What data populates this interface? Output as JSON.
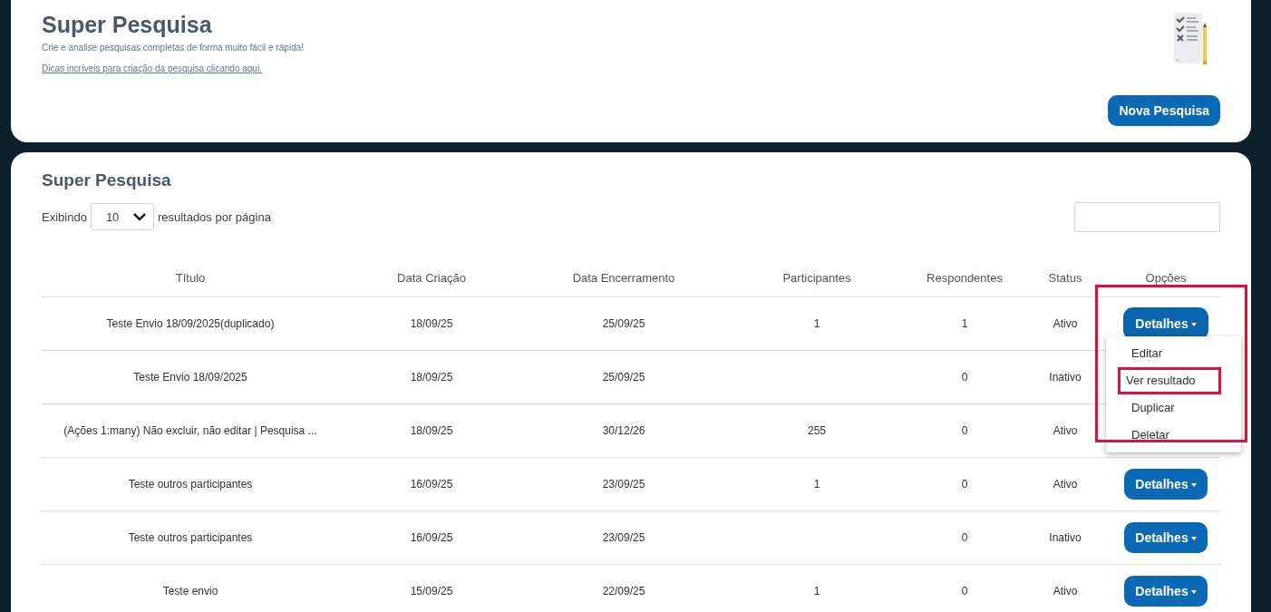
{
  "header": {
    "title": "Super Pesquisa",
    "subtitle": "Crie e analise pesquisas completas de forma muito fácil e rápida!",
    "tips_link": "Dicas incríveis para criação da pesquisa clicando aqui.",
    "new_button": "Nova Pesquisa"
  },
  "list": {
    "title": "Super Pesquisa",
    "show_prefix": "Exibindo",
    "page_size": "10",
    "show_suffix": "resultados por página",
    "columns": [
      "Título",
      "Data Criação",
      "Data Encerramento",
      "Participantes",
      "Respondentes",
      "Status",
      "Opções"
    ],
    "rows": [
      {
        "cells": [
          "Teste Envio 18/09/2025(duplicado)",
          "18/09/25",
          "25/09/25",
          "1",
          "1",
          "Ativo"
        ],
        "options": "Detalhes",
        "menu_open": true
      },
      {
        "cells": [
          "Teste Envio 18/09/2025",
          "18/09/25",
          "25/09/25",
          "",
          "0",
          "Inativo"
        ],
        "menu_open": false
      },
      {
        "cells": [
          "(Ações 1:many) Não excluir, não editar | Pesquisa ...",
          "18/09/25",
          "30/12/26",
          "255",
          "0",
          "Ativo"
        ],
        "menu_open": false
      },
      {
        "cells": [
          "Teste outros participantes",
          "16/09/25",
          "23/09/25",
          "1",
          "0",
          "Ativo"
        ],
        "options": "Detalhes",
        "menu_open": false
      },
      {
        "cells": [
          "Teste outros participantes",
          "16/09/25",
          "23/09/25",
          "",
          "0",
          "Inativo"
        ],
        "options": "Detalhes",
        "menu_open": false
      },
      {
        "cells": [
          "Teste envio",
          "15/09/25",
          "22/09/25",
          "1",
          "0",
          "Ativo"
        ],
        "options": "Detalhes",
        "menu_open": false
      }
    ],
    "menu": {
      "highlighted": true,
      "items": [
        {
          "label": "Editar",
          "highlighted": false
        },
        {
          "label": "Ver resultado",
          "highlighted": true
        },
        {
          "label": "Duplicar",
          "highlighted": false
        },
        {
          "label": "Deletar",
          "highlighted": false
        }
      ]
    }
  }
}
